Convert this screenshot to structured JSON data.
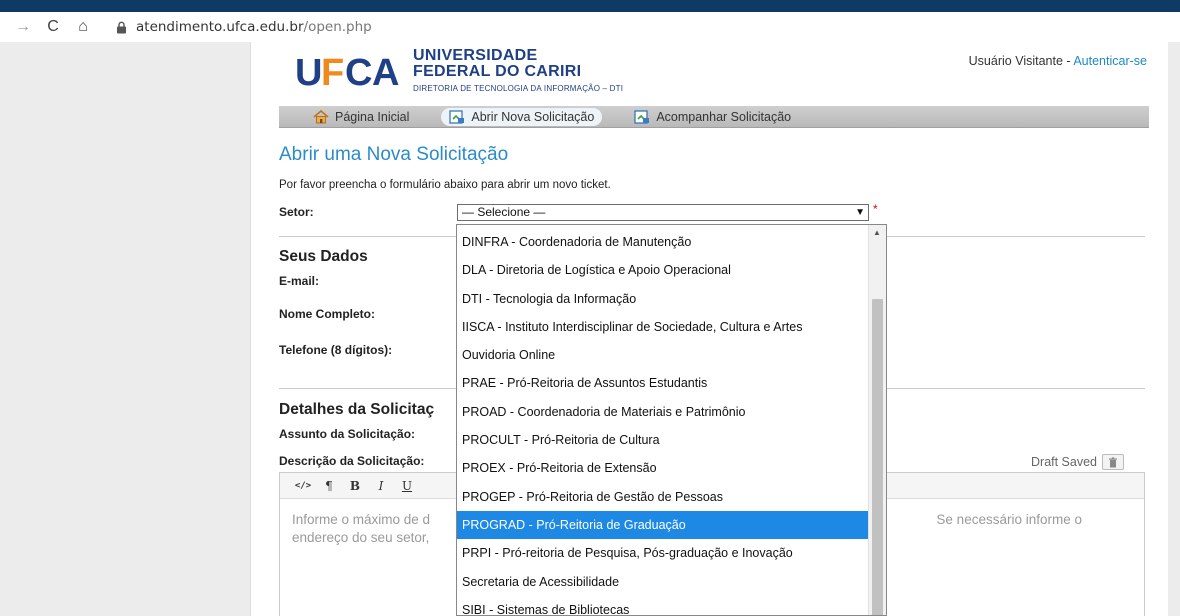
{
  "browser": {
    "url_host": "atendimento.ufca.edu.br",
    "url_path": "/open.php"
  },
  "header": {
    "logo_line1": "UNIVERSIDADE",
    "logo_line2": "FEDERAL DO CARIRI",
    "logo_sub": "DIRETORIA DE TECNOLOGIA DA INFORMAÇÃO – DTI",
    "user_label": "Usuário Visitante - ",
    "login_link": "Autenticar-se"
  },
  "nav": {
    "home": "Página Inicial",
    "new_ticket": "Abrir Nova Solicitação",
    "track_ticket": "Acompanhar Solicitação"
  },
  "form": {
    "title": "Abrir uma Nova Solicitação",
    "intro": "Por favor preencha o formulário abaixo para abrir um novo ticket.",
    "setor_label": "Setor:",
    "setor_value": "— Selecione —",
    "required_mark": "*",
    "section_user": "Seus Dados",
    "email_label": "E-mail:",
    "name_label": "Nome Completo:",
    "phone_label": "Telefone (8 dígitos):",
    "section_details": "Detalhes da Solicitaç",
    "subject_label": "Assunto da Solicitação:",
    "description_label": "Descrição da Solicitação:",
    "draft_status": "Draft Saved",
    "editor_placeholder_a": "Informe o máximo de d",
    "editor_placeholder_b": "Se necessário informe o",
    "editor_placeholder_c": "endereço do seu setor,"
  },
  "editor_toolbar": [
    "</>",
    "¶",
    "B",
    "I",
    "U"
  ],
  "dropdown": {
    "options": [
      "DINFRA - Coordenadoria de Manutenção",
      "DLA - Diretoria de Logística e Apoio Operacional",
      "DTI - Tecnologia da Informação",
      "IISCA - Instituto Interdisciplinar de Sociedade, Cultura e Artes",
      "Ouvidoria Online",
      "PRAE - Pró-Reitoria de Assuntos Estudantis",
      "PROAD - Coordenadoria de Materiais e Patrimônio",
      "PROCULT - Pró-Reitoria de Cultura",
      "PROEX - Pró-Reitoria de Extensão",
      "PROGEP - Pró-Reitoria de Gestão de Pessoas",
      "PROGRAD - Pró-Reitoria de Graduação",
      "PRPI - Pró-reitoria de Pesquisa, Pós-graduação e Inovação",
      "Secretaria de Acessibilidade",
      "SIBI - Sistemas de Bibliotecas"
    ],
    "highlighted": "PROGRAD - Pró-Reitoria de Graduação"
  },
  "colors": {
    "accent": "#2a8bc9",
    "highlight": "#1e88e5",
    "logo_blue": "#1f3f86",
    "logo_orange": "#f08a1c"
  },
  "icons": {
    "back": "arrow-left-icon",
    "reload": "reload-icon",
    "home": "home-icon",
    "lock": "lock-icon",
    "ticket": "ticket-icon",
    "trash": "trash-icon"
  }
}
